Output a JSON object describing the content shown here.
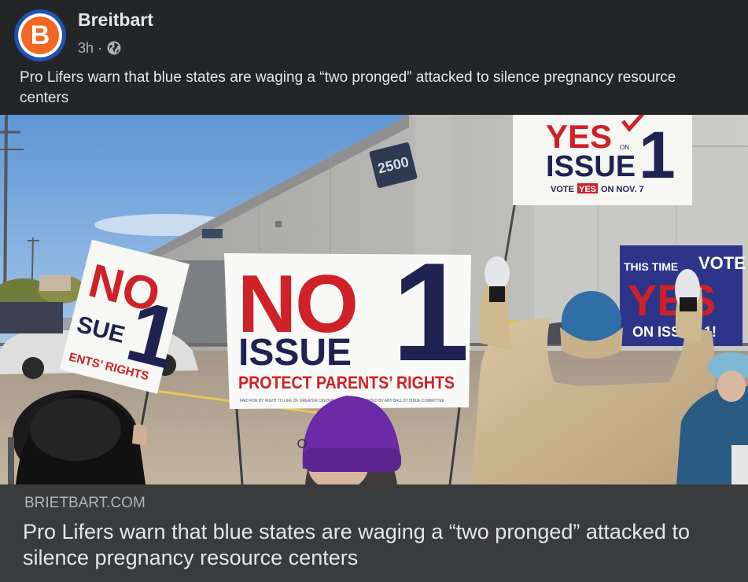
{
  "post": {
    "page_name": "Breitbart",
    "avatar_letter": "B",
    "time": "3h",
    "separator": "·",
    "audience_icon": "globe-icon",
    "text": "Pro Lifers warn that blue states are waging a “two pronged” attacked to silence pregnancy resource centers"
  },
  "photo": {
    "building_number": "2500",
    "signs": {
      "center": {
        "line1": "NO",
        "number": "1",
        "line2": "ISSUE",
        "line3": "PROTECT PARENTS’ RIGHTS",
        "fine_print": "PAID FOR BY RIGHT TO LIFE OF GREATER CINCINNATI · NOT AUTHORIZED BY ANY BALLOT ISSUE COMMITTEE"
      },
      "left": {
        "line1": "NO",
        "number": "1",
        "line2": "SUE",
        "line3": "ENTS’ RIGHTS"
      },
      "top_right": {
        "line1": "YES",
        "on": "ON",
        "number": "1",
        "line2": "ISSUE",
        "line3_pre": "VOTE",
        "line3_yes": "YES",
        "line3_post": "ON NOV. 7"
      },
      "right": {
        "line1": "THIS TIME",
        "line1b": "VOTE",
        "line2": "YES",
        "line3": "ON ISSUE 1!"
      }
    }
  },
  "link": {
    "domain": "BRIETBART.COM",
    "headline": "Pro Lifers warn that blue states are waging a “two pronged” attacked to silence pregnancy resource centers"
  },
  "colors": {
    "card_bg": "#242526",
    "link_bg": "#3a3b3c",
    "text_primary": "#e4e6eb",
    "text_secondary": "#b0b3b8",
    "avatar_ring": "#1e53b5",
    "avatar_fill": "#f26722",
    "sign_red": "#cf2128",
    "sign_navy": "#1f2352"
  }
}
